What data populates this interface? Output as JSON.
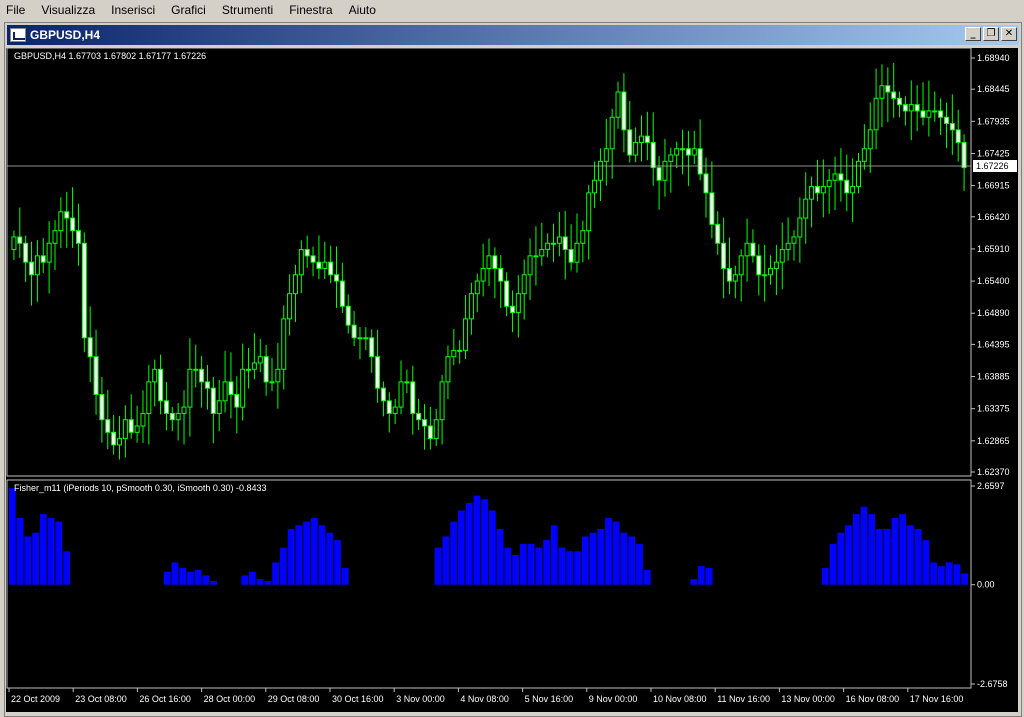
{
  "menu": [
    "File",
    "Visualizza",
    "Inserisci",
    "Grafici",
    "Strumenti",
    "Finestra",
    "Aiuto"
  ],
  "window": {
    "title": "GBPUSD,H4",
    "buttons": {
      "minimize": "_",
      "restore": "❐",
      "close": "✕"
    }
  },
  "chart_data": [
    {
      "type": "candlestick",
      "header": "GBPUSD,H4  1.67703 1.67802 1.67177 1.67226",
      "current_price": 1.67226,
      "current_price_label": "1.67226",
      "y_ticks": [
        "1.68940",
        "1.68445",
        "1.67935",
        "1.67425",
        "1.66915",
        "1.66420",
        "1.65910",
        "1.65400",
        "1.64890",
        "1.64395",
        "1.63885",
        "1.63375",
        "1.62865",
        "1.62370"
      ],
      "ylim": [
        1.6237,
        1.6894
      ],
      "candle_color": "#00ff00",
      "bull_fill": "#000000",
      "bear_fill": "#ffffff",
      "close_series": [
        1.661,
        1.66,
        1.657,
        1.655,
        1.658,
        1.657,
        1.66,
        1.662,
        1.665,
        1.664,
        1.662,
        1.66,
        1.645,
        1.642,
        1.636,
        1.632,
        1.63,
        1.628,
        1.629,
        1.632,
        1.63,
        1.631,
        1.633,
        1.638,
        1.64,
        1.635,
        1.633,
        1.632,
        1.633,
        1.634,
        1.64,
        1.64,
        1.638,
        1.637,
        1.633,
        1.635,
        1.638,
        1.636,
        1.634,
        1.64,
        1.64,
        1.641,
        1.642,
        1.638,
        1.638,
        1.64,
        1.648,
        1.652,
        1.655,
        1.659,
        1.658,
        1.657,
        1.656,
        1.657,
        1.655,
        1.654,
        1.65,
        1.647,
        1.645,
        1.645,
        1.645,
        1.642,
        1.637,
        1.635,
        1.633,
        1.634,
        1.638,
        1.638,
        1.633,
        1.632,
        1.631,
        1.629,
        1.632,
        1.638,
        1.642,
        1.643,
        1.643,
        1.648,
        1.652,
        1.654,
        1.656,
        1.658,
        1.656,
        1.654,
        1.65,
        1.649,
        1.652,
        1.655,
        1.658,
        1.658,
        1.659,
        1.66,
        1.66,
        1.661,
        1.659,
        1.657,
        1.66,
        1.662,
        1.668,
        1.67,
        1.673,
        1.675,
        1.68,
        1.684,
        1.678,
        1.674,
        1.676,
        1.677,
        1.676,
        1.672,
        1.67,
        1.673,
        1.674,
        1.675,
        1.675,
        1.674,
        1.675,
        1.671,
        1.668,
        1.663,
        1.66,
        1.656,
        1.654,
        1.655,
        1.658,
        1.66,
        1.658,
        1.655,
        1.655,
        1.656,
        1.657,
        1.659,
        1.66,
        1.661,
        1.664,
        1.667,
        1.669,
        1.668,
        1.669,
        1.67,
        1.671,
        1.67,
        1.668,
        1.669,
        1.673,
        1.675,
        1.678,
        1.683,
        1.685,
        1.684,
        1.683,
        1.682,
        1.681,
        1.682,
        1.681,
        1.68,
        1.681,
        1.681,
        1.68,
        1.679,
        1.678,
        1.676,
        1.672
      ],
      "x_ticks": [
        "22 Oct 2009",
        "23 Oct 08:00",
        "26 Oct 16:00",
        "28 Oct 00:00",
        "29 Oct 08:00",
        "30 Oct 16:00",
        "3 Nov 00:00",
        "4 Nov 08:00",
        "5 Nov 16:00",
        "9 Nov 00:00",
        "10 Nov 08:00",
        "11 Nov 16:00",
        "13 Nov 00:00",
        "16 Nov 08:00",
        "17 Nov 16:00"
      ]
    },
    {
      "type": "bar",
      "header": "Fisher_m11  (iPeriods 10, pSmooth 0.30, iSmooth 0.30)  -0.8433",
      "y_ticks": [
        "2.6597",
        "0.00",
        "-2.6758"
      ],
      "ylim": [
        -2.6758,
        2.6597
      ],
      "bar_color": "#0000ff",
      "values": [
        2.6,
        1.8,
        1.3,
        1.4,
        1.9,
        1.8,
        1.7,
        0.9,
        0,
        0,
        0,
        0,
        0,
        0,
        0,
        0,
        0,
        0,
        0,
        0,
        0.35,
        0.6,
        0.45,
        0.35,
        0.4,
        0.25,
        0.1,
        0,
        0,
        0,
        0.25,
        0.35,
        0.15,
        0.1,
        0.6,
        1.0,
        1.5,
        1.6,
        1.7,
        1.8,
        1.6,
        1.4,
        1.2,
        0.45,
        0,
        0,
        0,
        0,
        0,
        0,
        0,
        0,
        0,
        0,
        0,
        1.0,
        1.3,
        1.7,
        2.0,
        2.2,
        2.4,
        2.3,
        2.0,
        1.5,
        1.0,
        0.8,
        1.1,
        1.1,
        1.0,
        1.2,
        1.6,
        1.0,
        0.9,
        0.9,
        1.3,
        1.4,
        1.5,
        1.8,
        1.7,
        1.4,
        1.3,
        1.1,
        0.4,
        0,
        0,
        0,
        0,
        0,
        0.15,
        0.5,
        0.45,
        0,
        0,
        0,
        0,
        0,
        0,
        0,
        0,
        0,
        0,
        0,
        0,
        0,
        0,
        0.45,
        1.1,
        1.4,
        1.6,
        1.9,
        2.1,
        1.9,
        1.5,
        1.5,
        1.8,
        1.9,
        1.6,
        1.5,
        1.2,
        0.6,
        0.5,
        0.6,
        0.55,
        0.3
      ]
    }
  ]
}
